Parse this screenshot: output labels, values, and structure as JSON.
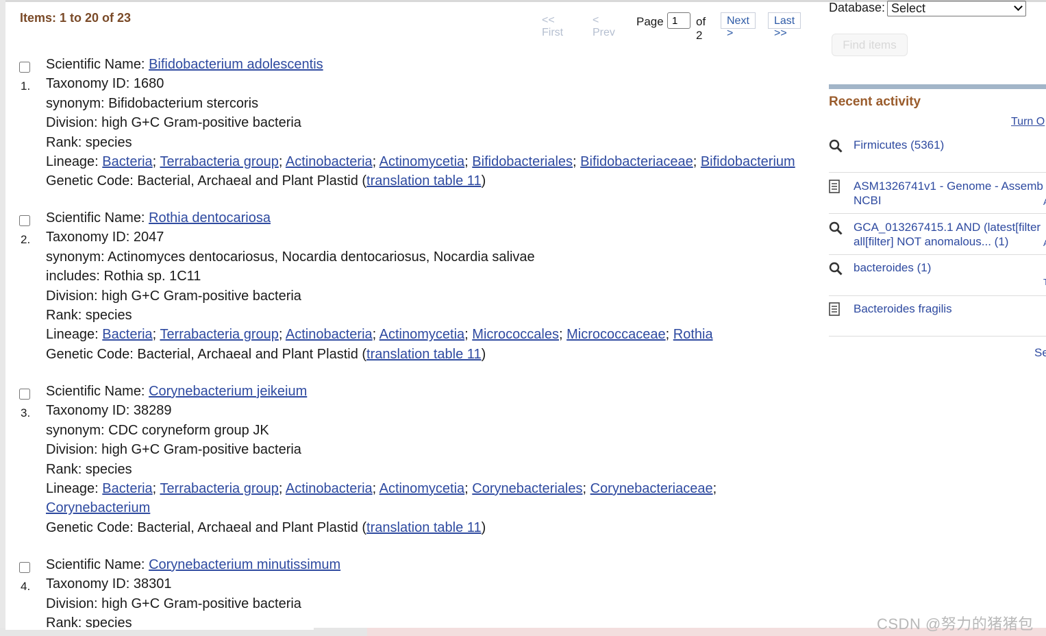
{
  "pager": {
    "items_label": "Items: 1 to 20 of 23",
    "first": "<< First",
    "prev": "< Prev",
    "page_label": "Page",
    "page_value": "1",
    "of_label": "of 2",
    "next": "Next >",
    "last": "Last >>"
  },
  "results": [
    {
      "number": "1.",
      "sci_label": "Scientific Name: ",
      "sci_name": "Bifidobacterium adolescentis",
      "taxid": "Taxonomy ID: 1680",
      "extra": [
        "synonym: Bifidobacterium stercoris"
      ],
      "division": "Division: high G+C Gram-positive bacteria",
      "rank": "Rank: species",
      "lineage_label": "Lineage: ",
      "lineage": [
        "Bacteria",
        "Terrabacteria group",
        "Actinobacteria",
        "Actinomycetia",
        "Bifidobacteriales",
        "Bifidobacteriaceae",
        "Bifidobacterium"
      ],
      "lineage_wrap_after": null,
      "genetic_label": "Genetic Code: Bacterial, Archaeal and Plant Plastid (",
      "genetic_link": "translation table 11",
      "genetic_close": ")"
    },
    {
      "number": "2.",
      "sci_label": "Scientific Name: ",
      "sci_name": "Rothia dentocariosa",
      "taxid": "Taxonomy ID: 2047",
      "extra": [
        "synonym: Actinomyces dentocariosus, Nocardia dentocariosus, Nocardia salivae",
        "includes: Rothia sp. 1C11"
      ],
      "division": "Division: high G+C Gram-positive bacteria",
      "rank": "Rank: species",
      "lineage_label": "Lineage: ",
      "lineage": [
        "Bacteria",
        "Terrabacteria group",
        "Actinobacteria",
        "Actinomycetia",
        "Micrococcales",
        "Micrococcaceae",
        "Rothia"
      ],
      "lineage_wrap_after": null,
      "genetic_label": "Genetic Code: Bacterial, Archaeal and Plant Plastid (",
      "genetic_link": "translation table 11",
      "genetic_close": ")"
    },
    {
      "number": "3.",
      "sci_label": "Scientific Name: ",
      "sci_name": "Corynebacterium jeikeium",
      "taxid": "Taxonomy ID: 38289",
      "extra": [
        "synonym: CDC coryneform group JK"
      ],
      "division": "Division: high G+C Gram-positive bacteria",
      "rank": "Rank: species",
      "lineage_label": "Lineage: ",
      "lineage": [
        "Bacteria",
        "Terrabacteria group",
        "Actinobacteria",
        "Actinomycetia",
        "Corynebacteriales",
        "Corynebacteriaceae",
        "Corynebacterium"
      ],
      "lineage_wrap_after": 5,
      "genetic_label": "Genetic Code: Bacterial, Archaeal and Plant Plastid (",
      "genetic_link": "translation table 11",
      "genetic_close": ")"
    },
    {
      "number": "4.",
      "sci_label": "Scientific Name: ",
      "sci_name": "Corynebacterium minutissimum",
      "taxid": "Taxonomy ID: 38301",
      "extra": [],
      "division": "Division: high G+C Gram-positive bacteria",
      "rank": "Rank: species",
      "lineage_label": "",
      "lineage": [],
      "lineage_wrap_after": null,
      "genetic_label": "",
      "genetic_link": "",
      "genetic_close": ""
    }
  ],
  "sidebar": {
    "database_label": "Database:",
    "database_value": "Select",
    "find_button": "Find items",
    "recent_title": "Recent activity",
    "turn_off": "Turn O",
    "recent_items": [
      {
        "icon": "search-icon",
        "lines": [
          "Firmicutes (5361)"
        ],
        "right": ""
      },
      {
        "icon": "document-icon",
        "lines": [
          "ASM1326741v1 - Genome - Assemb",
          "NCBI"
        ],
        "right": "A"
      },
      {
        "icon": "search-icon",
        "lines": [
          "GCA_013267415.1 AND (latest[filter",
          "all[filter] NOT anomalous... (1)"
        ],
        "right": "A"
      },
      {
        "icon": "search-icon",
        "lines": [
          "bacteroides (1)"
        ],
        "right": "T"
      },
      {
        "icon": "document-icon",
        "lines": [
          "Bacteroides fragilis"
        ],
        "right": ""
      }
    ],
    "see_more": "Se"
  },
  "watermark": "CSDN @努力的猪猪包"
}
